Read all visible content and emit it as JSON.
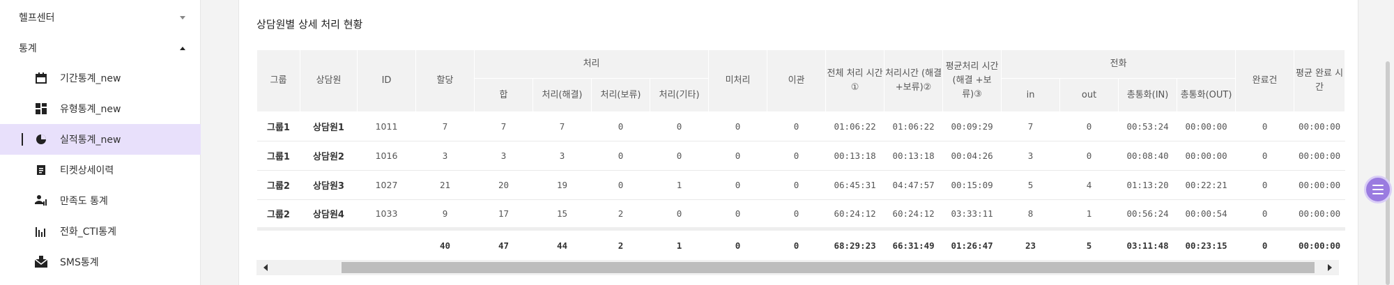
{
  "sidebar": {
    "groups": [
      {
        "label": "헬프센터",
        "expanded": false
      },
      {
        "label": "통계",
        "expanded": true
      }
    ],
    "items": [
      {
        "label": "기간통계_new",
        "icon": "calendar-icon"
      },
      {
        "label": "유형통계_new",
        "icon": "grid-icon"
      },
      {
        "label": "실적통계_new",
        "icon": "pie-chart-icon",
        "active": true
      },
      {
        "label": "티켓상세이력",
        "icon": "document-icon"
      },
      {
        "label": "만족도 통계",
        "icon": "user-chart-icon"
      },
      {
        "label": "전화_CTI통계",
        "icon": "bar-chart-icon"
      },
      {
        "label": "SMS통계",
        "icon": "envelope-icon"
      }
    ]
  },
  "panel": {
    "title": "상담원별 상세 처리 현황"
  },
  "table": {
    "headers": {
      "group": "그룹",
      "agent": "상담원",
      "id": "ID",
      "assigned": "할당",
      "processing": "처리",
      "processing_sub": [
        "합",
        "처리(해결)",
        "처리(보류)",
        "처리(기타)"
      ],
      "unprocessed": "미처리",
      "transfer": "이관",
      "total_time": "전체 처리 시간①",
      "proc_time": "처리시간 (해결+보류)②",
      "avg_proc": "평균처리 시간 (해결 +보류)③",
      "call": "전화",
      "call_sub": [
        "in",
        "out",
        "총통화(IN)",
        "총통화(OUT)"
      ],
      "completed": "완료건",
      "avg_complete": "평균 완료 시간"
    },
    "rows": [
      {
        "group": "그룹1",
        "agent": "상담원1",
        "id": "1011",
        "assigned": "7",
        "sum": "7",
        "resolved": "7",
        "hold": "0",
        "other": "0",
        "unprocessed": "0",
        "transfer": "0",
        "total_time": "01:06:22",
        "proc_time": "01:06:22",
        "avg_proc": "00:09:29",
        "in": "7",
        "out": "0",
        "talk_in": "00:53:24",
        "talk_out": "00:00:00",
        "completed": "0",
        "avg_complete": "00:00:00"
      },
      {
        "group": "그룹1",
        "agent": "상담원2",
        "id": "1016",
        "assigned": "3",
        "sum": "3",
        "resolved": "3",
        "hold": "0",
        "other": "0",
        "unprocessed": "0",
        "transfer": "0",
        "total_time": "00:13:18",
        "proc_time": "00:13:18",
        "avg_proc": "00:04:26",
        "in": "3",
        "out": "0",
        "talk_in": "00:08:40",
        "talk_out": "00:00:00",
        "completed": "0",
        "avg_complete": "00:00:00"
      },
      {
        "group": "그룹2",
        "agent": "상담원3",
        "id": "1027",
        "assigned": "21",
        "sum": "20",
        "resolved": "19",
        "hold": "0",
        "other": "1",
        "unprocessed": "0",
        "transfer": "0",
        "total_time": "06:45:31",
        "proc_time": "04:47:57",
        "avg_proc": "00:15:09",
        "in": "5",
        "out": "4",
        "talk_in": "01:13:20",
        "talk_out": "00:22:21",
        "completed": "0",
        "avg_complete": "00:00:00"
      },
      {
        "group": "그룹2",
        "agent": "상담원4",
        "id": "1033",
        "assigned": "9",
        "sum": "17",
        "resolved": "15",
        "hold": "2",
        "other": "0",
        "unprocessed": "0",
        "transfer": "0",
        "total_time": "60:24:12",
        "proc_time": "60:24:12",
        "avg_proc": "03:33:11",
        "in": "8",
        "out": "1",
        "talk_in": "00:56:24",
        "talk_out": "00:00:54",
        "completed": "0",
        "avg_complete": "00:00:00"
      }
    ],
    "summary": {
      "assigned": "40",
      "sum": "47",
      "resolved": "44",
      "hold": "2",
      "other": "1",
      "unprocessed": "0",
      "transfer": "0",
      "total_time": "68:29:23",
      "proc_time": "66:31:49",
      "avg_proc": "01:26:47",
      "in": "23",
      "out": "5",
      "talk_in": "03:11:48",
      "talk_out": "00:23:15",
      "completed": "0",
      "avg_complete": "00:00:00"
    }
  },
  "colors": {
    "accent": "#9a7be0",
    "active_bg": "#e8e0fb",
    "header_bg": "#f2f2f2"
  }
}
